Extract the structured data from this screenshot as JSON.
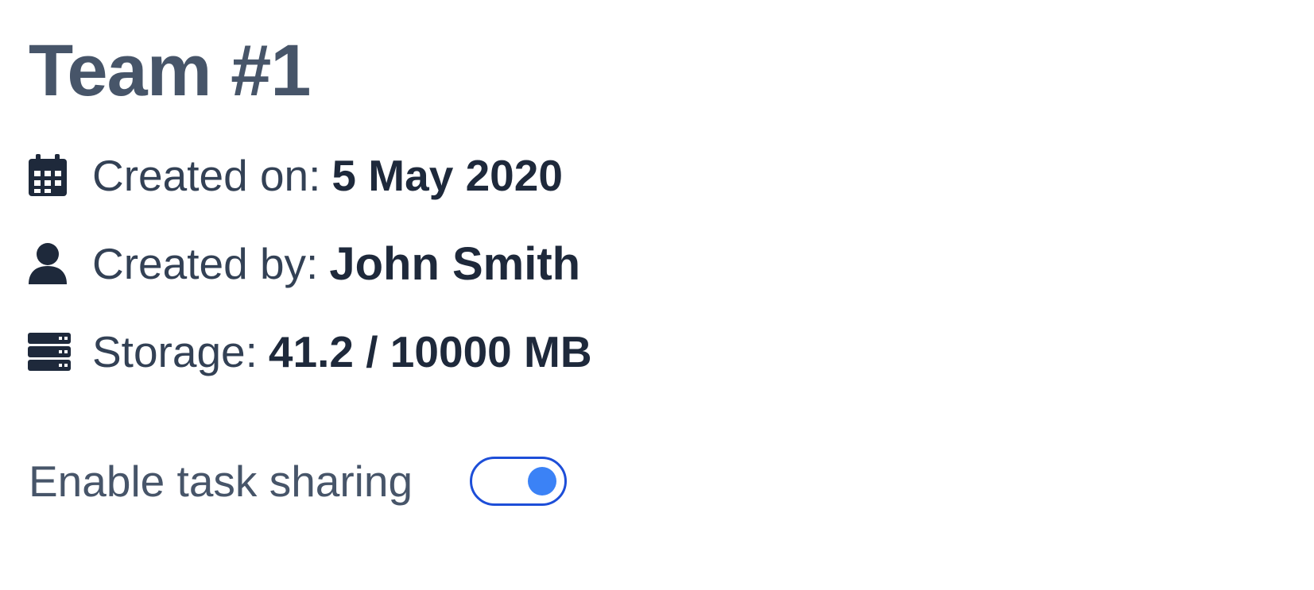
{
  "team": {
    "title": "Team #1"
  },
  "details": {
    "created_on": {
      "icon": "calendar-icon",
      "label": "Created on:",
      "value": "5 May 2020"
    },
    "created_by": {
      "icon": "user-icon",
      "label": "Created by:",
      "value": "John Smith"
    },
    "storage": {
      "icon": "server-icon",
      "label": "Storage:",
      "value": "41.2 / 10000 MB"
    }
  },
  "task_sharing": {
    "label": "Enable task sharing",
    "enabled": true
  },
  "colors": {
    "title": "#475569",
    "text": "#334155",
    "value": "#1e293b",
    "toggle_border": "#1d4ed8",
    "toggle_knob": "#3b82f6"
  }
}
